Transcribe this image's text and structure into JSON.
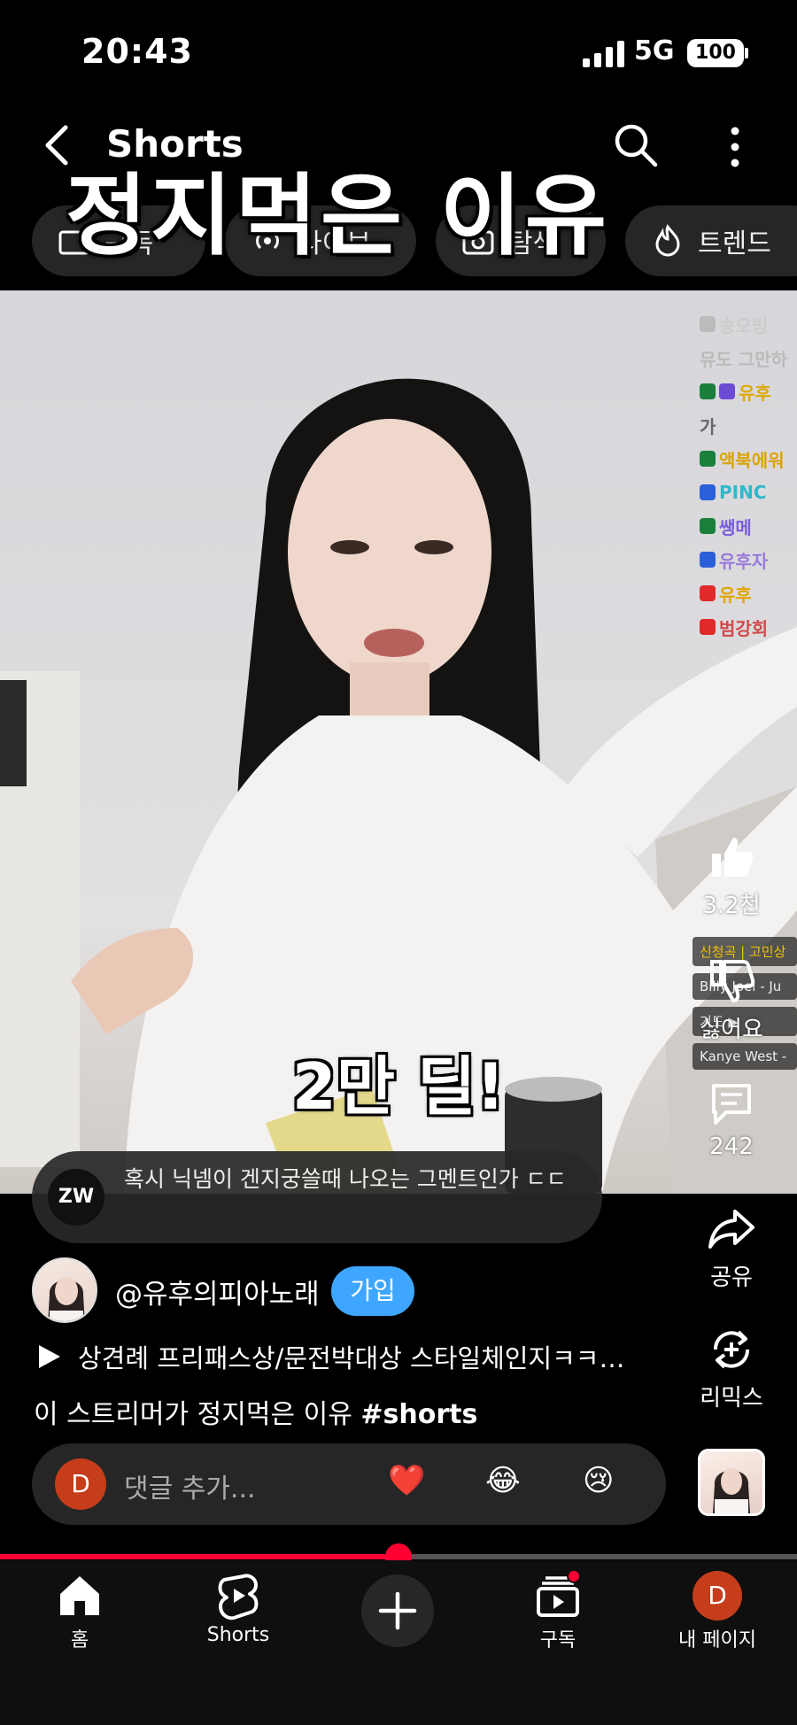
{
  "status_bar": {
    "time": "20:43",
    "network": "5G",
    "battery": "100"
  },
  "header": {
    "title": "Shorts"
  },
  "chips": [
    "구독",
    "라이브",
    "탐색",
    "트렌드"
  ],
  "overlay_title": "정지먹은 이유",
  "video": {
    "caption": "2만 딜!",
    "chat_overlay": [
      "송오빙",
      "뮤도 그만하",
      "유후",
      "가",
      "액북에워",
      "PINC",
      "쌩메",
      "유후자",
      "유후",
      "범강회"
    ],
    "side_chat": [
      "신청곡 | 고민상",
      "Billy Joel - Ju",
      "기도 ▶",
      "Kanye West -"
    ]
  },
  "comment_preview": {
    "avatar_label": "ZW",
    "text": "혹시 닉넴이 겐지궁쓸때 나오는 그멘트인가 ㄷㄷ"
  },
  "rail": {
    "like_count": "3.2천",
    "dislike_label": "싫어요",
    "comment_count": "242",
    "share_label": "공유",
    "remix_label": "리믹스"
  },
  "channel": {
    "name": "@유후의피아노래",
    "join_label": "가입"
  },
  "music": {
    "text": "상견례 프리패스상/문전박대상 스타일체인지ㅋㅋ…"
  },
  "description": {
    "text": "이 스트리머가 정지먹은 이유",
    "hashtag": "#shorts"
  },
  "add_comment": {
    "avatar": "D",
    "placeholder": "댓글 추가...",
    "emojis": [
      "❤️",
      "😂",
      "😢"
    ]
  },
  "progress": {
    "fraction": 0.5
  },
  "bottom_nav": {
    "home": "홈",
    "shorts": "Shorts",
    "subscriptions": "구독",
    "me_avatar": "D",
    "me": "내 페이지"
  },
  "colors": {
    "accent_red": "#ff0033",
    "join_blue": "#3ea6ff",
    "avatar_orange": "#c53d1b"
  }
}
